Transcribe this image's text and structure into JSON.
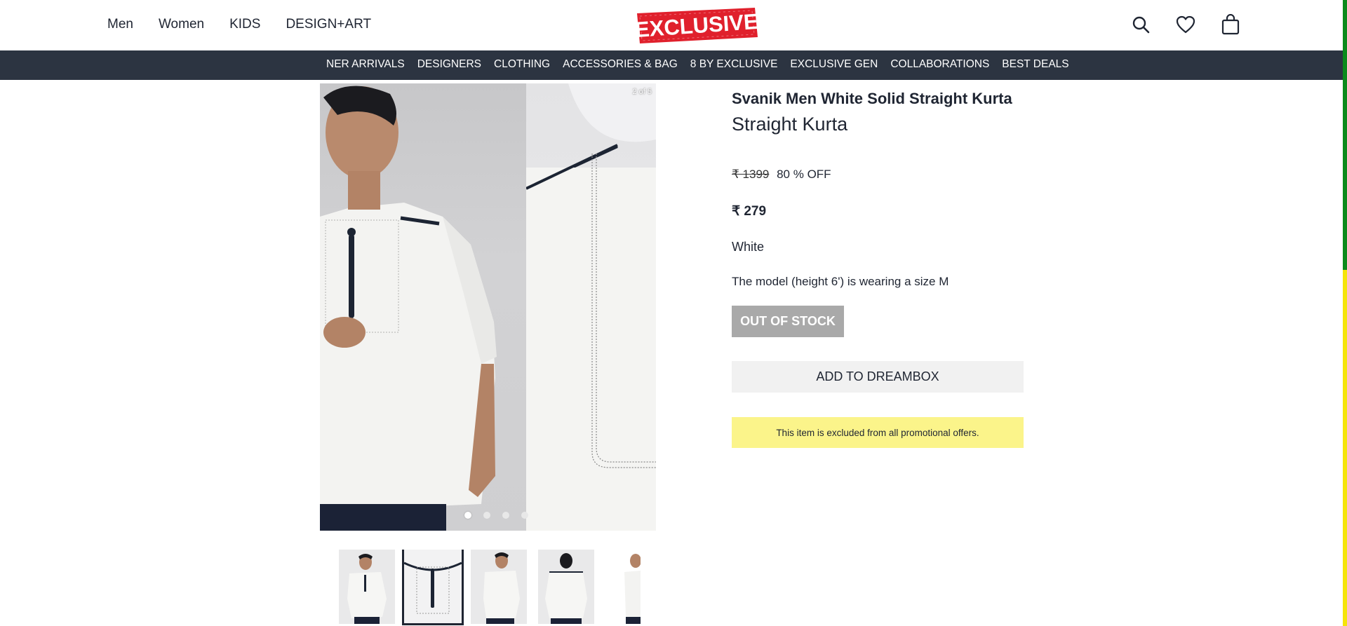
{
  "header": {
    "nav": [
      "Men",
      "Women",
      "KIDS",
      "DESIGN+ART"
    ],
    "logo_text": "EXCLUSIVE",
    "icons": [
      "search-icon",
      "heart-icon",
      "bag-icon"
    ]
  },
  "categories": [
    "NER ARRIVALS",
    "DESIGNERS",
    "CLOTHING",
    "ACCESSORIES & BAG",
    "8 BY EXCLUSIVE",
    "EXCLUSIVE GEN",
    "COLLABORATIONS",
    "BEST DEALS"
  ],
  "gallery": {
    "counter": "2 of 5",
    "dot_count": 4,
    "active_dot": 0,
    "thumbnail_count": 5,
    "selected_thumbnail": 1
  },
  "product": {
    "title": "Svanik Men White Solid Straight Kurta",
    "subtitle": "Straight Kurta",
    "mrp": "₹ 1399",
    "discount": "80 % OFF",
    "price": "₹ 279",
    "color": "White",
    "model_note": "The model (height 6') is wearing a size M",
    "stock_label": "OUT OF STOCK",
    "dreambox_label": "ADD TO DREAMBOX",
    "promo_note": "This item is excluded from all promotional offers."
  },
  "colors": {
    "nav_bg": "#2c3441",
    "logo_red": "#e0202c",
    "promo_bg": "#fbf48a",
    "rail_green": "#0b8a1b",
    "rail_yellow": "#f5e40a"
  }
}
